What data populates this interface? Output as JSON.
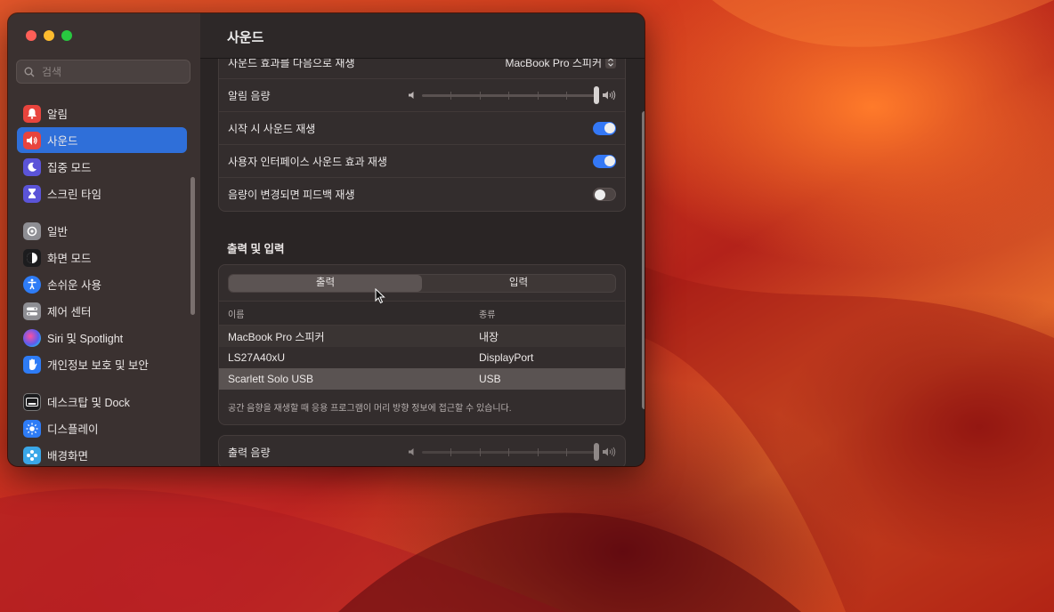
{
  "window": {
    "title": "사운드",
    "search_placeholder": "검색"
  },
  "sidebar": {
    "items": [
      {
        "label": "알림",
        "icon": "bell-icon",
        "color": "#e8443d",
        "active": false
      },
      {
        "label": "사운드",
        "icon": "speaker-icon",
        "color": "#e8443d",
        "active": true
      },
      {
        "label": "집중 모드",
        "icon": "moon-icon",
        "color": "#5b54d8",
        "active": false
      },
      {
        "label": "스크린 타임",
        "icon": "hourglass-icon",
        "color": "#5b54d8",
        "active": false
      },
      {
        "label": "일반",
        "icon": "gear-icon",
        "color": "#8e8e93",
        "active": false
      },
      {
        "label": "화면 모드",
        "icon": "appearance-icon",
        "color": "#1c1c1e",
        "active": false
      },
      {
        "label": "손쉬운 사용",
        "icon": "accessibility-icon",
        "color": "#2e7cf6",
        "active": false
      },
      {
        "label": "제어 센터",
        "icon": "control-center-icon",
        "color": "#8e8e93",
        "active": false
      },
      {
        "label": "Siri 및 Spotlight",
        "icon": "siri-icon",
        "color": "#2b2b2b",
        "active": false
      },
      {
        "label": "개인정보 보호 및 보안",
        "icon": "hand-icon",
        "color": "#2e7cf6",
        "active": false
      },
      {
        "label": "데스크탑 및 Dock",
        "icon": "dock-icon",
        "color": "#1c1c1e",
        "active": false
      },
      {
        "label": "디스플레이",
        "icon": "sun-icon",
        "color": "#2e7cf6",
        "active": false
      },
      {
        "label": "배경화면",
        "icon": "wallpaper-icon",
        "color": "#3aa7e8",
        "active": false
      }
    ]
  },
  "sound_effects": {
    "play_through_label": "사운드 효과를 다음으로 재생",
    "play_through_value": "MacBook Pro 스피커",
    "alert_volume_label": "알림 음량",
    "startup_sound_label": "시작 시 사운드 재생",
    "startup_sound_on": true,
    "ui_sound_label": "사용자 인터페이스 사운드 효과 재생",
    "ui_sound_on": true,
    "feedback_label": "음량이 변경되면 피드백 재생",
    "feedback_on": false
  },
  "output_input": {
    "section_title": "출력 및 입력",
    "tab_output": "출력",
    "tab_input": "입력",
    "col_name": "이름",
    "col_type": "종류",
    "devices": [
      {
        "name": "MacBook Pro 스피커",
        "type": "내장"
      },
      {
        "name": "LS27A40xU",
        "type": "DisplayPort"
      },
      {
        "name": "Scarlett Solo USB",
        "type": "USB"
      }
    ],
    "note": "공간 음향을 재생할 때 응용 프로그램이 머리 방향 정보에 접근할 수 있습니다.",
    "output_volume_label": "출력 음량"
  }
}
